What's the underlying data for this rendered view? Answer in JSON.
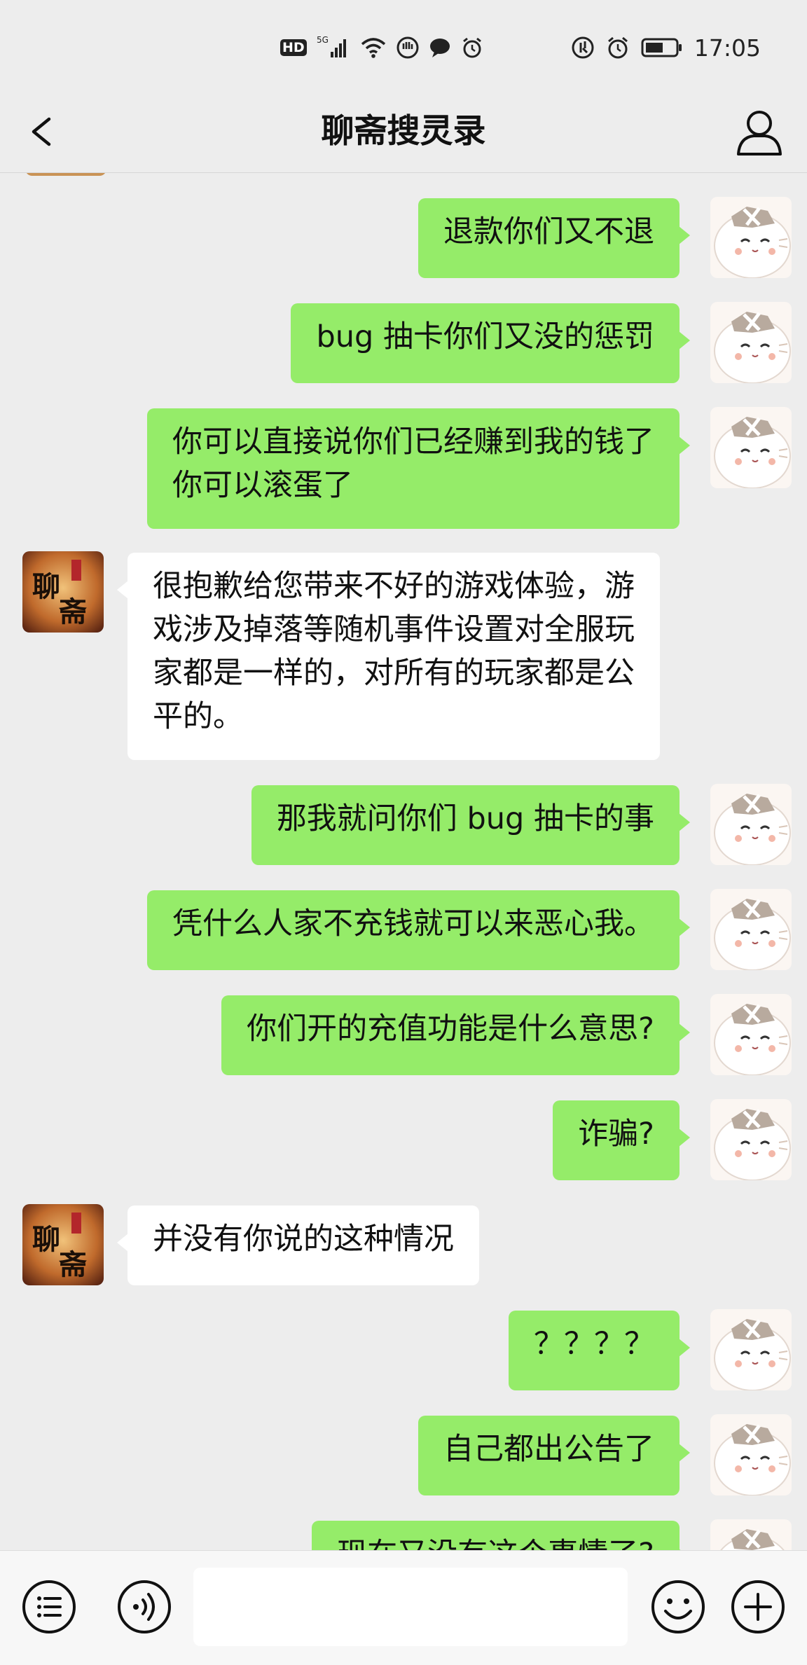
{
  "status_bar": {
    "hd_label": "HD",
    "network_label": "5G",
    "time": "17:05"
  },
  "header": {
    "title": "聊斋搜灵录"
  },
  "colors": {
    "my_bubble": "#95ec69",
    "their_bubble": "#ffffff",
    "background": "#ededed"
  },
  "messages": [
    {
      "sender": "me",
      "text": "退款你们又不退"
    },
    {
      "sender": "me",
      "text": "bug 抽卡你们又没的惩罚"
    },
    {
      "sender": "me",
      "text": "你可以直接说你们已经赚到我的钱了\n你可以滚蛋了"
    },
    {
      "sender": "them",
      "text": "很抱歉给您带来不好的游戏体验，游\n戏涉及掉落等随机事件设置对全服玩\n家都是一样的，对所有的玩家都是公\n平的。"
    },
    {
      "sender": "me",
      "text": "那我就问你们 bug 抽卡的事"
    },
    {
      "sender": "me",
      "text": "凭什么人家不充钱就可以来恶心我。"
    },
    {
      "sender": "me",
      "text": "你们开的充值功能是什么意思?"
    },
    {
      "sender": "me",
      "text": "诈骗?"
    },
    {
      "sender": "them",
      "text": "并没有你说的这种情况"
    },
    {
      "sender": "me",
      "text": "？？？？"
    },
    {
      "sender": "me",
      "text": "自己都出公告了"
    },
    {
      "sender": "me",
      "text": "现在又没有这个事情了?"
    }
  ],
  "avatar_logo_text": "聊斋",
  "icons": {
    "back": "chevron-left-icon",
    "profile": "person-icon",
    "menu": "list-menu-icon",
    "voice": "voice-icon",
    "emoji": "emoji-icon",
    "add": "plus-circle-icon"
  }
}
